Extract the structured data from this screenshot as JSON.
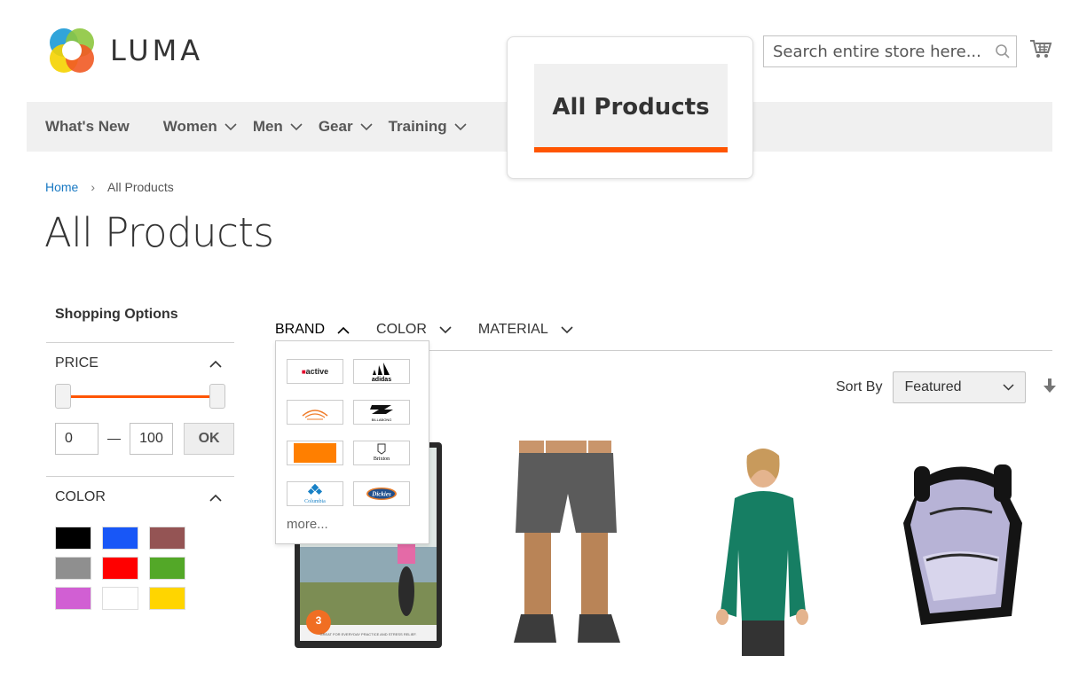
{
  "header": {
    "logo_text": "LUMA",
    "search_placeholder": "Search entire store here...",
    "cart_icon": "cart-icon"
  },
  "nav": {
    "items": [
      {
        "label": "What's New",
        "has_dropdown": false
      },
      {
        "label": "Women",
        "has_dropdown": true
      },
      {
        "label": "Men",
        "has_dropdown": true
      },
      {
        "label": "Gear",
        "has_dropdown": true
      },
      {
        "label": "Training",
        "has_dropdown": true
      }
    ],
    "highlight_tab": "All Products",
    "accent_color": "#ff5501"
  },
  "breadcrumb": {
    "home": "Home",
    "current": "All Products"
  },
  "page_title": "All Products",
  "sidebar": {
    "heading": "Shopping Options",
    "price": {
      "title": "PRICE",
      "min": "0",
      "max": "100",
      "ok_label": "OK"
    },
    "color": {
      "title": "COLOR",
      "swatches": [
        "#000000",
        "#1857f7",
        "#945454",
        "#8f8f8f",
        "#ff0000",
        "#53a828",
        "#d15fd3",
        "#ffffff",
        "#ffd500"
      ]
    }
  },
  "filter_tabs": [
    {
      "label": "BRAND",
      "expanded": true
    },
    {
      "label": "COLOR",
      "expanded": false
    },
    {
      "label": "MATERIAL",
      "expanded": false
    }
  ],
  "brand_dropdown": {
    "brands": [
      "active",
      "adidas",
      "",
      "BILLABONG",
      "",
      "Brixton",
      "Columbia",
      "Dickies"
    ],
    "more_label": "more..."
  },
  "sort": {
    "label": "Sort By",
    "selected": "Featured"
  },
  "products": [
    {
      "name": "yoga-dvd",
      "badge": "3",
      "caption": "GREAT FOR EVERYDAY PRACTICE AND STRESS RELIEF."
    },
    {
      "name": "shorts"
    },
    {
      "name": "green-top"
    },
    {
      "name": "backpack"
    }
  ]
}
